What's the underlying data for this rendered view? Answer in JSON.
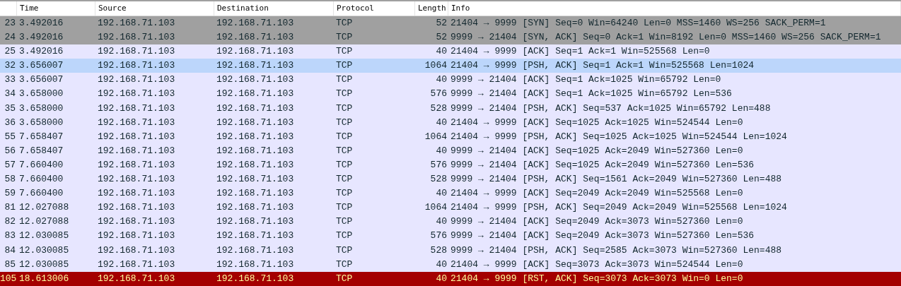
{
  "packet_list": {
    "columns": [
      "Time",
      "Source",
      "Destination",
      "Protocol",
      "Length",
      "Info"
    ],
    "rows": [
      {
        "no": "23",
        "time": "3.492016",
        "source": "192.168.71.103",
        "destination": "192.168.71.103",
        "protocol": "TCP",
        "length": "52",
        "info": "21404 → 9999 [SYN] Seq=0 Win=64240 Len=0 MSS=1460 WS=256 SACK_PERM=1",
        "kind": "syn",
        "selected": false
      },
      {
        "no": "24",
        "time": "3.492016",
        "source": "192.168.71.103",
        "destination": "192.168.71.103",
        "protocol": "TCP",
        "length": "52",
        "info": "9999 → 21404 [SYN, ACK] Seq=0 Ack=1 Win=8192 Len=0 MSS=1460 WS=256 SACK_PERM=1",
        "kind": "syn",
        "selected": false
      },
      {
        "no": "25",
        "time": "3.492016",
        "source": "192.168.71.103",
        "destination": "192.168.71.103",
        "protocol": "TCP",
        "length": "40",
        "info": "21404 → 9999 [ACK] Seq=1 Ack=1 Win=525568 Len=0",
        "kind": "tcp",
        "selected": false
      },
      {
        "no": "32",
        "time": "3.656007",
        "source": "192.168.71.103",
        "destination": "192.168.71.103",
        "protocol": "TCP",
        "length": "1064",
        "info": "21404 → 9999 [PSH, ACK] Seq=1 Ack=1 Win=525568 Len=1024",
        "kind": "tcp",
        "selected": true
      },
      {
        "no": "33",
        "time": "3.656007",
        "source": "192.168.71.103",
        "destination": "192.168.71.103",
        "protocol": "TCP",
        "length": "40",
        "info": "9999 → 21404 [ACK] Seq=1 Ack=1025 Win=65792 Len=0",
        "kind": "tcp",
        "selected": false
      },
      {
        "no": "34",
        "time": "3.658000",
        "source": "192.168.71.103",
        "destination": "192.168.71.103",
        "protocol": "TCP",
        "length": "576",
        "info": "9999 → 21404 [ACK] Seq=1 Ack=1025 Win=65792 Len=536",
        "kind": "tcp",
        "selected": false
      },
      {
        "no": "35",
        "time": "3.658000",
        "source": "192.168.71.103",
        "destination": "192.168.71.103",
        "protocol": "TCP",
        "length": "528",
        "info": "9999 → 21404 [PSH, ACK] Seq=537 Ack=1025 Win=65792 Len=488",
        "kind": "tcp",
        "selected": false
      },
      {
        "no": "36",
        "time": "3.658000",
        "source": "192.168.71.103",
        "destination": "192.168.71.103",
        "protocol": "TCP",
        "length": "40",
        "info": "21404 → 9999 [ACK] Seq=1025 Ack=1025 Win=524544 Len=0",
        "kind": "tcp",
        "selected": false
      },
      {
        "no": "55",
        "time": "7.658407",
        "source": "192.168.71.103",
        "destination": "192.168.71.103",
        "protocol": "TCP",
        "length": "1064",
        "info": "21404 → 9999 [PSH, ACK] Seq=1025 Ack=1025 Win=524544 Len=1024",
        "kind": "tcp",
        "selected": false
      },
      {
        "no": "56",
        "time": "7.658407",
        "source": "192.168.71.103",
        "destination": "192.168.71.103",
        "protocol": "TCP",
        "length": "40",
        "info": "9999 → 21404 [ACK] Seq=1025 Ack=2049 Win=527360 Len=0",
        "kind": "tcp",
        "selected": false
      },
      {
        "no": "57",
        "time": "7.660400",
        "source": "192.168.71.103",
        "destination": "192.168.71.103",
        "protocol": "TCP",
        "length": "576",
        "info": "9999 → 21404 [ACK] Seq=1025 Ack=2049 Win=527360 Len=536",
        "kind": "tcp",
        "selected": false
      },
      {
        "no": "58",
        "time": "7.660400",
        "source": "192.168.71.103",
        "destination": "192.168.71.103",
        "protocol": "TCP",
        "length": "528",
        "info": "9999 → 21404 [PSH, ACK] Seq=1561 Ack=2049 Win=527360 Len=488",
        "kind": "tcp",
        "selected": false
      },
      {
        "no": "59",
        "time": "7.660400",
        "source": "192.168.71.103",
        "destination": "192.168.71.103",
        "protocol": "TCP",
        "length": "40",
        "info": "21404 → 9999 [ACK] Seq=2049 Ack=2049 Win=525568 Len=0",
        "kind": "tcp",
        "selected": false
      },
      {
        "no": "81",
        "time": "12.027088",
        "source": "192.168.71.103",
        "destination": "192.168.71.103",
        "protocol": "TCP",
        "length": "1064",
        "info": "21404 → 9999 [PSH, ACK] Seq=2049 Ack=2049 Win=525568 Len=1024",
        "kind": "tcp",
        "selected": false
      },
      {
        "no": "82",
        "time": "12.027088",
        "source": "192.168.71.103",
        "destination": "192.168.71.103",
        "protocol": "TCP",
        "length": "40",
        "info": "9999 → 21404 [ACK] Seq=2049 Ack=3073 Win=527360 Len=0",
        "kind": "tcp",
        "selected": false
      },
      {
        "no": "83",
        "time": "12.030085",
        "source": "192.168.71.103",
        "destination": "192.168.71.103",
        "protocol": "TCP",
        "length": "576",
        "info": "9999 → 21404 [ACK] Seq=2049 Ack=3073 Win=527360 Len=536",
        "kind": "tcp",
        "selected": false
      },
      {
        "no": "84",
        "time": "12.030085",
        "source": "192.168.71.103",
        "destination": "192.168.71.103",
        "protocol": "TCP",
        "length": "528",
        "info": "9999 → 21404 [PSH, ACK] Seq=2585 Ack=3073 Win=527360 Len=488",
        "kind": "tcp",
        "selected": false
      },
      {
        "no": "85",
        "time": "12.030085",
        "source": "192.168.71.103",
        "destination": "192.168.71.103",
        "protocol": "TCP",
        "length": "40",
        "info": "21404 → 9999 [ACK] Seq=3073 Ack=3073 Win=524544 Len=0",
        "kind": "tcp",
        "selected": false
      },
      {
        "no": "105",
        "time": "18.613006",
        "source": "192.168.71.103",
        "destination": "192.168.71.103",
        "protocol": "TCP",
        "length": "40",
        "info": "21404 → 9999 [RST, ACK] Seq=3073 Ack=3073 Win=0 Len=0",
        "kind": "rst",
        "selected": false
      }
    ]
  }
}
